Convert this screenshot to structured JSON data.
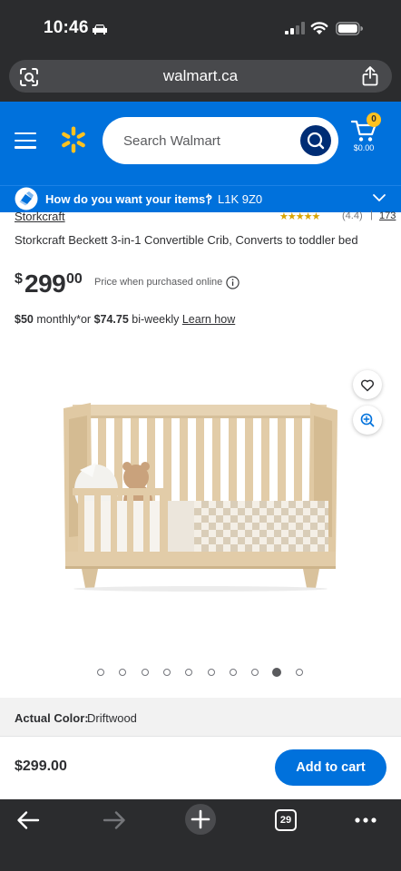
{
  "status_bar": {
    "time": "10:46"
  },
  "browser": {
    "url": "walmart.ca",
    "tabs_count": "29"
  },
  "header": {
    "search_placeholder": "Search Walmart",
    "cart_count": "0",
    "cart_amount": "$0.00",
    "brand_color": "#0071dc",
    "spark_color": "#ffc220"
  },
  "delivery": {
    "prompt": "How do you want your items?",
    "separator": "|",
    "postal_code": "L1K 9Z0"
  },
  "product": {
    "brand": "Storkcraft",
    "rating_stars": "★★★★★",
    "rating_value": "(4.4)",
    "rating_separator": "|",
    "review_count": "173",
    "title": "Storkcraft Beckett 3-in-1 Convertible Crib, Converts to toddler bed",
    "price_currency": "$",
    "price_dollars": "299",
    "price_cents": "00",
    "price_note": "Price when purchased online",
    "monthly_amount": "$50",
    "monthly_text": " monthly*or ",
    "biweekly_amount": "$74.75",
    "biweekly_text": " bi-weekly ",
    "learn_how": "Learn how",
    "image_count": 10,
    "active_image_index": 8,
    "color_label": "Actual Color:",
    "color_value": "Driftwood"
  },
  "sticky_footer": {
    "price": "$299.00",
    "add_to_cart": "Add to cart"
  }
}
